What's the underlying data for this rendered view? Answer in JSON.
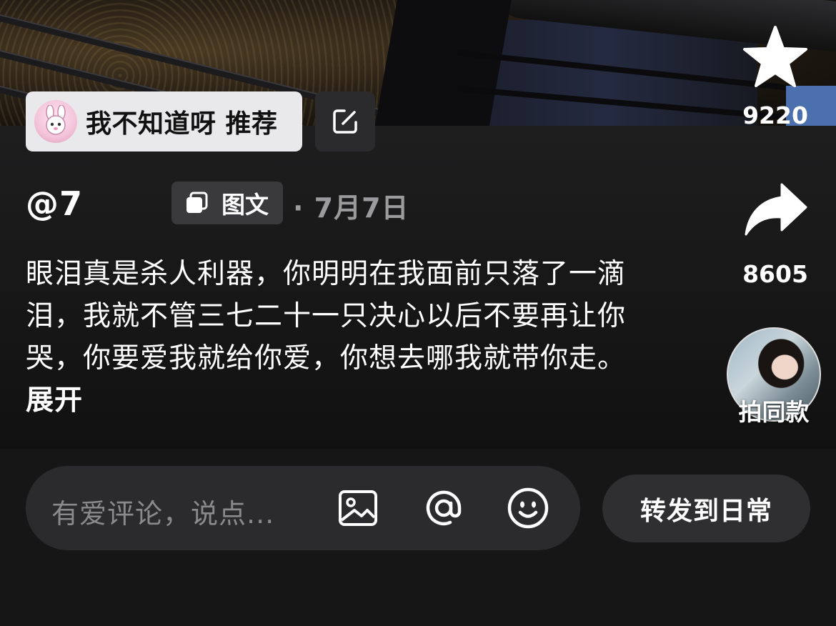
{
  "topic": {
    "label": "我不知道呀  推荐"
  },
  "actions": {
    "favorite_count": "9220",
    "share_count": "8605",
    "same_style_label": "拍同款"
  },
  "post": {
    "author": "@7",
    "type_label": "图文",
    "date": "· 7月7日",
    "body": "眼泪真是杀人利器，你明明在我面前只落了一滴泪，我就不管三七二十一只决心以后不要再让你哭，你要爱我就给你爱，你想去哪我就带你走。",
    "expand_label": "展开"
  },
  "comment_bar": {
    "placeholder": "有爱评论，说点...",
    "repost_label": "转发到日常"
  },
  "icons": {
    "favorite": "star-icon",
    "share": "share-arrow-icon",
    "edit": "edit-icon",
    "image": "image-icon",
    "mention": "at-icon",
    "emoji": "emoji-icon",
    "type": "gallery-icon"
  }
}
